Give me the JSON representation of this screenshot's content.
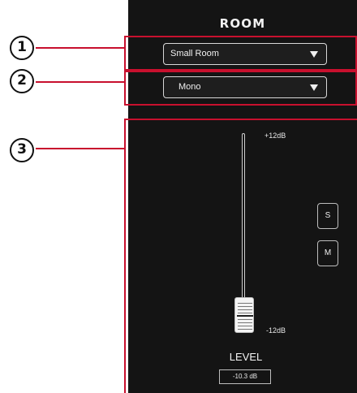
{
  "panel": {
    "title": "ROOM",
    "background": "#141414"
  },
  "callouts": [
    {
      "number": "1"
    },
    {
      "number": "2"
    },
    {
      "number": "3"
    }
  ],
  "callout_color": "#c8102e",
  "room_dropdown": {
    "value": "Small Room",
    "icon": "chevron-down-icon"
  },
  "mode_dropdown": {
    "value": "Mono",
    "icon": "chevron-down-icon"
  },
  "fader": {
    "max_label": "+12dB",
    "min_label": "-12dB",
    "label": "LEVEL",
    "readout": "-10.3 dB",
    "level_db": -10.3
  },
  "buttons": {
    "solo": "S",
    "mute": "M"
  }
}
